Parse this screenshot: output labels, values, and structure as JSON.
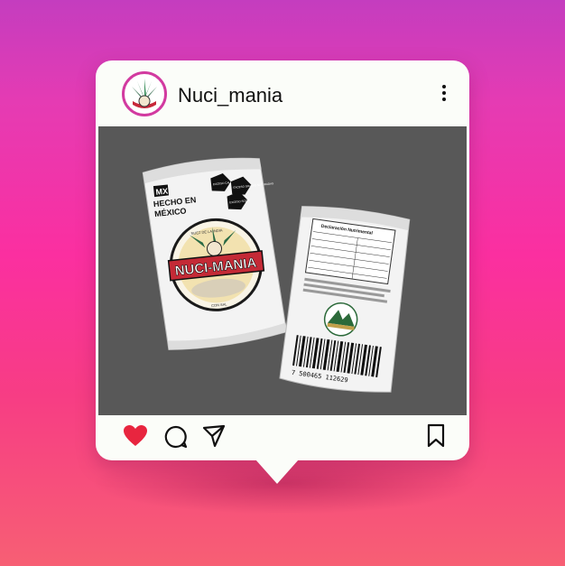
{
  "post": {
    "username": "Nuci_mania",
    "avatar_icon": "agave-peanut-logo-icon",
    "more_icon": "more-vertical-icon"
  },
  "image": {
    "front_bag": {
      "badge": "MX",
      "made_in_line1": "HECHO EN",
      "made_in_line2": "MÉXICO",
      "brand": "NUCI-MANIA",
      "top_arc": "NUEZ DE LA INDIA",
      "bottom_arc": "CON SAL",
      "warning_1": "EXCESO CALORÍAS",
      "warning_2": "EXCESO GRASAS SATURADAS",
      "warning_3": "EXCESO SODIO"
    },
    "back_bag": {
      "nutrition_title": "Declaración Nutrimental",
      "barcode_number": "7 500465 112629"
    }
  },
  "actions": {
    "like_icon": "heart-icon",
    "comment_icon": "comment-icon",
    "share_icon": "send-icon",
    "save_icon": "bookmark-icon",
    "like_color": "#e8253f"
  }
}
